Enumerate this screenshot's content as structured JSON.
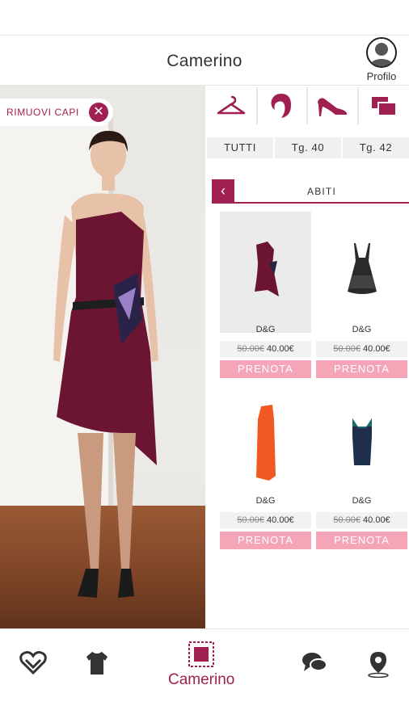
{
  "header": {
    "title": "Camerino",
    "profile_label": "Profilo"
  },
  "stage": {
    "remove_label": "RIMUOVI CAPI",
    "remove_icon": "close-icon"
  },
  "categories": [
    {
      "name": "hanger-icon"
    },
    {
      "name": "hair-icon"
    },
    {
      "name": "shoe-icon"
    },
    {
      "name": "layers-icon"
    }
  ],
  "sizes": [
    "TUTTI",
    "Tg. 40",
    "Tg. 42"
  ],
  "section": {
    "title": "ABITI",
    "back_icon": "chevron-left-icon"
  },
  "products": [
    {
      "brand": "D&G",
      "old_price": "50.00€",
      "price": "40.00€",
      "button": "PRENOTA",
      "color": "#6b1533"
    },
    {
      "brand": "D&G",
      "old_price": "50.00€",
      "price": "40.00€",
      "button": "PRENOTA",
      "color": "#2a2a2a"
    },
    {
      "brand": "D&G",
      "old_price": "50.00€",
      "price": "40.00€",
      "button": "PRENOTA",
      "color": "#f05a22"
    },
    {
      "brand": "D&G",
      "old_price": "50.00€",
      "price": "40.00€",
      "button": "PRENOTA",
      "color": "#1f2e4a"
    }
  ],
  "nav": {
    "active_label": "Camerino"
  },
  "colors": {
    "accent": "#a02052",
    "button_pink": "#f4a5b8",
    "dress": "#6b1533"
  }
}
